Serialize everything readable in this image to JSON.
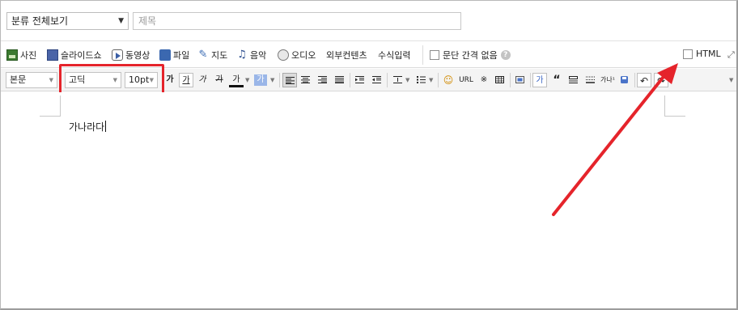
{
  "header": {
    "category_select": "분류 전체보기",
    "title_placeholder": "제목"
  },
  "insert_bar": {
    "items": [
      "사진",
      "슬라이드쇼",
      "동영상",
      "파일",
      "지도",
      "음악",
      "오디오",
      "외부컨텐츠",
      "수식입력"
    ],
    "paragraph_spacing": "문단 간격 없음",
    "html_toggle": "HTML"
  },
  "format_bar": {
    "paragraph_style": "본문",
    "font_family": "고딕",
    "font_size": "10pt",
    "bold": "가",
    "underline": "가",
    "italic": "가",
    "strike": "가",
    "font_color": "가",
    "bg_color": "가",
    "url": "URL",
    "asterism": "※",
    "highlight": "가",
    "quote": "“",
    "small_caps": "가나¹"
  },
  "editor": {
    "content": "가나라다"
  },
  "colors": {
    "highlight_box": "#e5242b",
    "arrow": "#e5242b"
  }
}
